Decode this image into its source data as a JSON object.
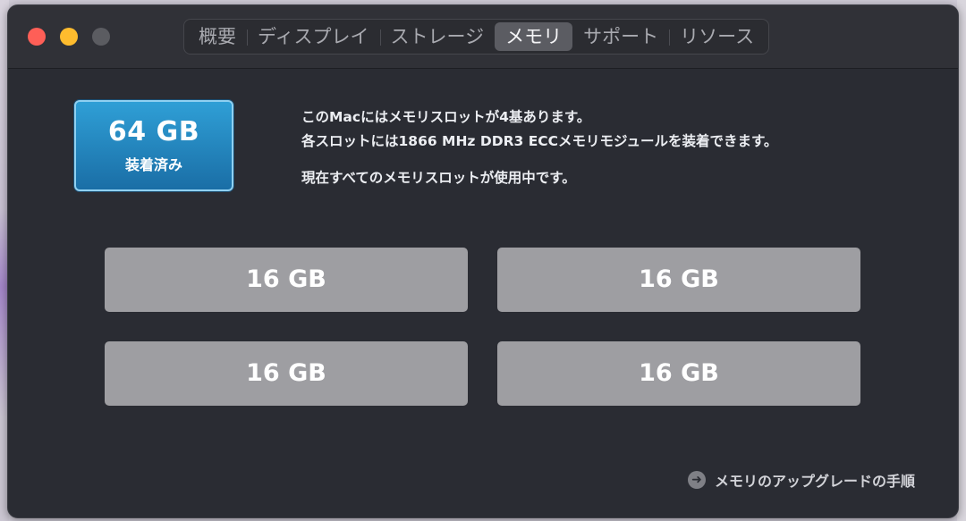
{
  "tabs": [
    {
      "label": "概要"
    },
    {
      "label": "ディスプレイ"
    },
    {
      "label": "ストレージ"
    },
    {
      "label": "メモリ"
    },
    {
      "label": "サポート"
    },
    {
      "label": "リソース"
    }
  ],
  "active_tab": "メモリ",
  "memory": {
    "installed_size": "64 GB",
    "installed_label": "装着済み",
    "description_lines": [
      "このMacにはメモリスロットが4基あります。",
      "各スロットには1866 MHz DDR3 ECCメモリモジュールを装着できます。",
      "現在すべてのメモリスロットが使用中です。"
    ],
    "slots": [
      {
        "size": "16 GB"
      },
      {
        "size": "16 GB"
      },
      {
        "size": "16 GB"
      },
      {
        "size": "16 GB"
      }
    ],
    "upgrade_link": "メモリのアップグレードの手順"
  },
  "icons": {
    "upgrade": "arrow-right-circle-icon"
  },
  "colors": {
    "window_bg": "#2a2c33",
    "installed_accent": "#1e88c7",
    "slot_bg": "#9e9ea2",
    "close": "#fe5f57",
    "minimize": "#febc2e"
  }
}
